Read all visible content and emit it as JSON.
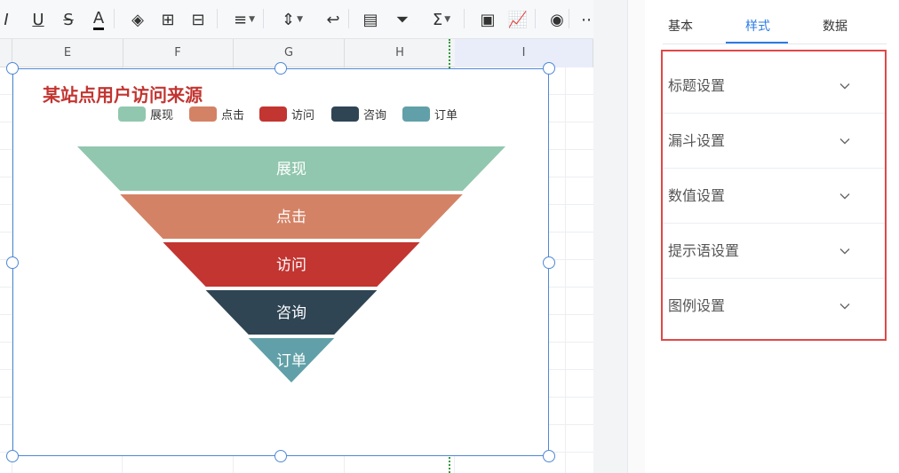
{
  "toolbar": {
    "buttons": [
      {
        "icon": "italic-icon",
        "glyph": "I"
      },
      {
        "icon": "underline-icon",
        "glyph": "U"
      },
      {
        "icon": "strikethrough-icon",
        "glyph": "S"
      },
      {
        "icon": "font-color-icon",
        "glyph": "A"
      },
      {
        "icon": "fill-color-icon",
        "glyph": "◈"
      },
      {
        "icon": "borders-icon",
        "glyph": "⊞"
      },
      {
        "icon": "merge-cells-icon",
        "glyph": "⊟"
      },
      {
        "icon": "align-left-icon",
        "glyph": "≡"
      },
      {
        "icon": "vertical-align-icon",
        "glyph": "⇕"
      },
      {
        "icon": "wrap-text-icon",
        "glyph": "↩"
      },
      {
        "icon": "table-icon",
        "glyph": "▤"
      },
      {
        "icon": "filter-icon",
        "glyph": "⏷"
      },
      {
        "icon": "sum-icon",
        "glyph": "Σ"
      },
      {
        "icon": "image-icon",
        "glyph": "▣"
      },
      {
        "icon": "chart-icon",
        "glyph": "📈"
      },
      {
        "icon": "eye-icon",
        "glyph": "◉"
      },
      {
        "icon": "more-icon",
        "glyph": "⋯"
      }
    ]
  },
  "columns": [
    "E",
    "F",
    "G",
    "H",
    "I"
  ],
  "chart": {
    "title": "某站点用户访问来源",
    "legend": [
      "展现",
      "点击",
      "访问",
      "咨询",
      "订单"
    ]
  },
  "chart_data": {
    "type": "funnel",
    "title": "某站点用户访问来源",
    "categories": [
      "展现",
      "点击",
      "访问",
      "咨询",
      "订单"
    ],
    "values": [
      100,
      80,
      60,
      40,
      20
    ],
    "colors": [
      "#91c7ae",
      "#d48265",
      "#c23531",
      "#2f4554",
      "#61a0a8"
    ],
    "legend_position": "top"
  },
  "panel": {
    "tabs": [
      "基本",
      "样式",
      "数据"
    ],
    "active_tab": "样式",
    "sections": [
      "标题设置",
      "漏斗设置",
      "数值设置",
      "提示语设置",
      "图例设置"
    ]
  },
  "colors": {
    "accent": "#2d7be5",
    "highlight_border": "#e04848",
    "selection": "#4e88d6"
  }
}
